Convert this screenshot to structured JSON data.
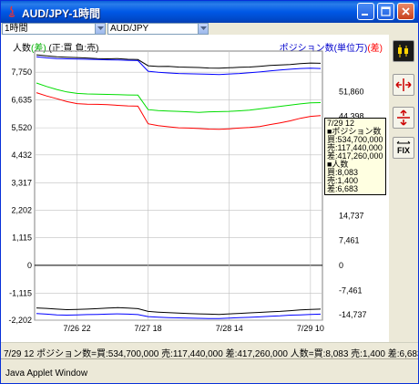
{
  "window": {
    "title": "AUD/JPY-1時間",
    "controls": [
      "minimize",
      "maximize",
      "close"
    ]
  },
  "selectors": {
    "period": "1時間",
    "pair": "AUD/JPY"
  },
  "legend": {
    "left_prefix": "人数",
    "left_diff": "(差)",
    "left_rest": "(正:買   負:売)",
    "right_prefix": "ポジション数(単位万)",
    "right_diff": "(差)"
  },
  "tooltip": {
    "lines": [
      "7/29 12",
      "■ポジション数",
      "買:534,700,000",
      "売:117,440,000",
      "差:417,260,000",
      "■人数",
      "買:8,083",
      "売:1,400",
      "差:6,683"
    ]
  },
  "sidebar_buttons": [
    "candlestick-icon",
    "horizontal-arrows-icon",
    "vertical-arrows-icon",
    "fix-icon"
  ],
  "sidebar_labels": {
    "fix": "FIX"
  },
  "status": "7/29 12   ポジション数=買:534,700,000 売:117,440,000 差:417,260,000 人数=買:8,083 売:1,400 差:6,683",
  "applet_label": "Java Applet Window",
  "colors": {
    "buy": "#000000",
    "sell": "#0000ff",
    "diff_count": "#00dd00",
    "diff_position": "#ff0000",
    "grid": "#c0c0c0",
    "title_bar": "#0058e6"
  },
  "chart_data": {
    "type": "line",
    "x_labels": [
      "7/26 22",
      "7/27 18",
      "7/28 14",
      "7/29 10"
    ],
    "left_axis": {
      "label": "人数",
      "ticks": [
        "7,750",
        "6,635",
        "5,520",
        "4,432",
        "3,317",
        "2,202",
        "1,115",
        "0",
        "-1,115",
        "-2,202"
      ]
    },
    "right_axis": {
      "label": "ポジション数(単位万)",
      "ticks": [
        "51,860",
        "44,398",
        "",
        "",
        "14,737",
        "7,461",
        "0",
        "-7,461",
        "-14,737"
      ]
    },
    "series": [
      {
        "color": "#000000",
        "values": [
          8450,
          8410,
          8370,
          8350,
          8340,
          8320,
          8300,
          8290,
          8300,
          8270,
          8260,
          8010,
          7980,
          7990,
          7960,
          7950,
          7940,
          7920,
          7910,
          7930,
          7950,
          7960,
          7990,
          8020,
          8040,
          8060,
          8100,
          8120,
          8110
        ]
      },
      {
        "color": "#0000ff",
        "values": [
          8370,
          8330,
          8300,
          8290,
          8280,
          8270,
          8260,
          8250,
          8240,
          8230,
          8220,
          7790,
          7750,
          7720,
          7700,
          7690,
          7680,
          7670,
          7660,
          7680,
          7700,
          7730,
          7760,
          7800,
          7840,
          7870,
          7900,
          7910,
          7900
        ]
      },
      {
        "color": "#00dd00",
        "values": [
          7320,
          7180,
          7060,
          6960,
          6900,
          6880,
          6870,
          6860,
          6850,
          6840,
          6830,
          6250,
          6210,
          6190,
          6180,
          6160,
          6140,
          6160,
          6170,
          6180,
          6200,
          6230,
          6280,
          6330,
          6380,
          6430,
          6480,
          6520,
          6530
        ]
      },
      {
        "color": "#ff0000",
        "values": [
          6930,
          6800,
          6690,
          6570,
          6490,
          6470,
          6460,
          6450,
          6420,
          6400,
          6390,
          5680,
          5610,
          5560,
          5520,
          5510,
          5490,
          5470,
          5460,
          5480,
          5510,
          5530,
          5570,
          5650,
          5720,
          5800,
          5900,
          5980,
          6010
        ]
      },
      {
        "color": "#000000",
        "values": [
          -1710,
          -1730,
          -1760,
          -1780,
          -1770,
          -1760,
          -1740,
          -1720,
          -1700,
          -1720,
          -1740,
          -1850,
          -1880,
          -1900,
          -1920,
          -1940,
          -1950,
          -1960,
          -1970,
          -1950,
          -1930,
          -1910,
          -1890,
          -1870,
          -1850,
          -1820,
          -1790,
          -1770,
          -1760
        ]
      },
      {
        "color": "#0000ff",
        "values": [
          -1940,
          -1960,
          -1990,
          -2000,
          -1990,
          -1980,
          -1970,
          -1960,
          -1950,
          -1960,
          -1980,
          -2060,
          -2080,
          -2100,
          -2110,
          -2120,
          -2130,
          -2140,
          -2140,
          -2120,
          -2100,
          -2090,
          -2070,
          -2050,
          -2030,
          -2000,
          -1990,
          -1970,
          -1960
        ]
      }
    ],
    "xlabel": "",
    "ylabel": "",
    "ylim": [
      -2202,
      8600
    ],
    "grid": true
  }
}
